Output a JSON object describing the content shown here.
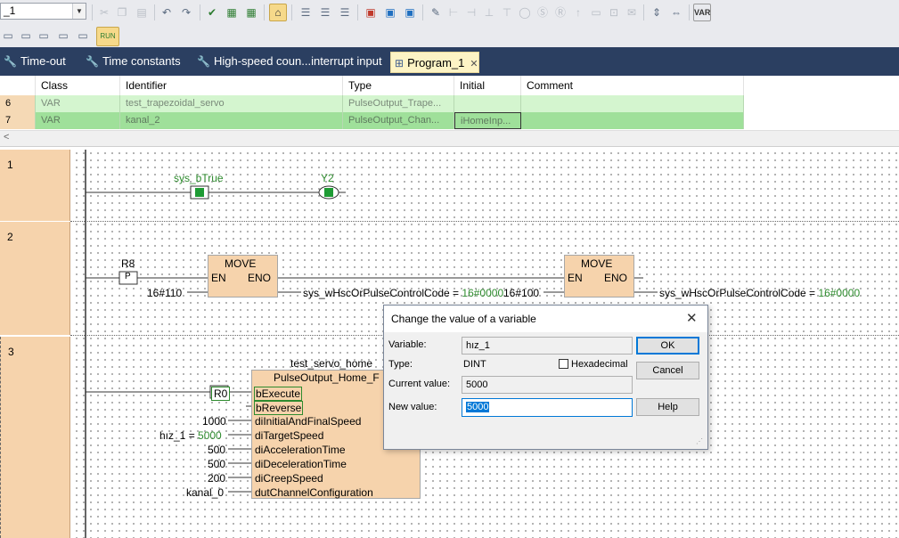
{
  "toolbar": {
    "combo_value": "_1",
    "icons": [
      "cut-icon",
      "copy-icon",
      "paste-icon",
      "undo-icon",
      "redo-icon",
      "check-icon",
      "grid-check-icon",
      "grid-check-2-icon",
      "monitor-icon",
      "list-icon",
      "list-2-icon",
      "list-3-icon",
      "table-icon",
      "chart-icon",
      "window-icon",
      "pen-icon",
      "contact-icons",
      "branch-icons",
      "lock-icons",
      "var-icon"
    ],
    "run_label": "RUN"
  },
  "tabs": [
    {
      "label": "Time-out",
      "icon": "wrench-icon"
    },
    {
      "label": "Time constants",
      "icon": "wrench-icon"
    },
    {
      "label": "High-speed coun...interrupt input",
      "icon": "wrench-icon"
    },
    {
      "label": "Program_1",
      "icon": "ladder-icon",
      "active": true,
      "close": "✕"
    }
  ],
  "var_table": {
    "headers": [
      "Class",
      "Identifier",
      "Type",
      "Initial",
      "Comment"
    ],
    "rows": [
      {
        "num": "6",
        "class": "VAR",
        "identifier": "test_trapezoidal_servo",
        "type": "PulseOutput_Trape...",
        "initial": "",
        "comment": ""
      },
      {
        "num": "7",
        "class": "VAR",
        "identifier": "kanal_2",
        "type": "PulseOutput_Chan...",
        "initial": "iHomeInp...",
        "comment": ""
      }
    ],
    "scroll_arrow": "<"
  },
  "ladder": {
    "network_numbers": [
      "1",
      "2",
      "3"
    ],
    "net1": {
      "contact": "sys_bTrue",
      "coil": "Y2"
    },
    "net2": {
      "contact": "R8",
      "edge": "P",
      "move1": {
        "title": "MOVE",
        "en": "EN",
        "eno": "ENO",
        "input": "16#110",
        "output": "sys_wHscOrPulseControlCode = ",
        "output_value": "16#0000"
      },
      "move2": {
        "title": "MOVE",
        "en": "EN",
        "eno": "ENO",
        "input": "16#100",
        "output": "sys_wHscOrPulseControlCode = ",
        "output_value": "16#0000"
      }
    },
    "net3": {
      "instance": "test_servo_home",
      "block": "PulseOutput_Home_F",
      "contact": "R0",
      "pins": [
        "bExecute",
        "bReverse",
        "diInitialAndFinalSpeed",
        "diTargetSpeed",
        "diAccelerationTime",
        "diDecelerationTime",
        "diCreepSpeed",
        "dutChannelConfiguration"
      ],
      "inputs": [
        "1000",
        "hız_1 = ",
        "5000",
        "500",
        "500",
        "200",
        "kanal_0"
      ]
    }
  },
  "dialog": {
    "title": "Change the value of a variable",
    "close": "✕",
    "variable_label": "Variable:",
    "variable_value": "hız_1",
    "type_label": "Type:",
    "type_value": "DINT",
    "hexadecimal_label": "Hexadecimal",
    "current_label": "Current value:",
    "current_value": "5000",
    "new_label": "New value:",
    "new_value": "5000",
    "ok": "OK",
    "cancel": "Cancel",
    "help": "Help"
  }
}
